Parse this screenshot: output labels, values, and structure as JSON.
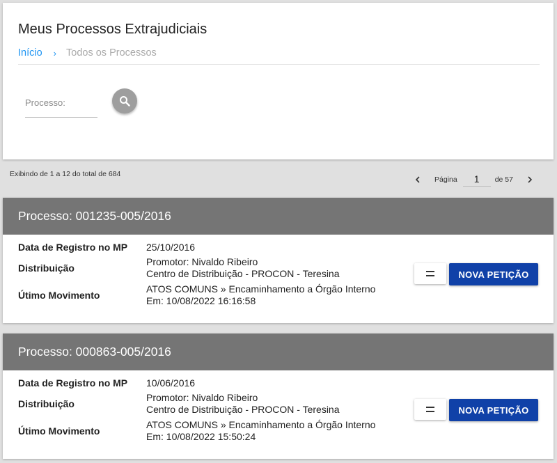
{
  "header": {
    "title": "Meus Processos Extrajudiciais",
    "breadcrumb": {
      "home": "Início",
      "current": "Todos os Processos"
    }
  },
  "search": {
    "placeholder": "Processo:",
    "value": ""
  },
  "results": {
    "summary": "Exibindo de 1 a 12 do total de 684"
  },
  "pagination": {
    "page_label": "Página",
    "current_page": "1",
    "of_label": "de 57"
  },
  "labels": {
    "registration_date": "Data de Registro no MP",
    "distribution": "Distribuição",
    "last_movement": "Útimo Movimento",
    "new_petition": "NOVA PETIÇÃO"
  },
  "processes": [
    {
      "title": "Processo: 001235-005/2016",
      "registration_date": "25/10/2016",
      "distribution_promoter": "Promotor: Nivaldo Ribeiro",
      "distribution_center": "Centro de Distribuição - PROCON - Teresina",
      "last_movement": "ATOS COMUNS » Encaminhamento a Órgão Interno",
      "last_movement_date": "Em: 10/08/2022 16:16:58"
    },
    {
      "title": "Processo: 000863-005/2016",
      "registration_date": "10/06/2016",
      "distribution_promoter": "Promotor: Nivaldo Ribeiro",
      "distribution_center": "Centro de Distribuição - PROCON - Teresina",
      "last_movement": "ATOS COMUNS » Encaminhamento a Órgão Interno",
      "last_movement_date": "Em: 10/08/2022 15:50:24"
    }
  ],
  "colors": {
    "accent": "#2196f3",
    "card_header": "#757575",
    "primary_button": "#1041a8",
    "background": "#e0e0e0"
  },
  "icons": {
    "search": "search-icon",
    "prev": "chevron-left-icon",
    "next": "chevron-right-icon",
    "menu": "menu-icon"
  }
}
